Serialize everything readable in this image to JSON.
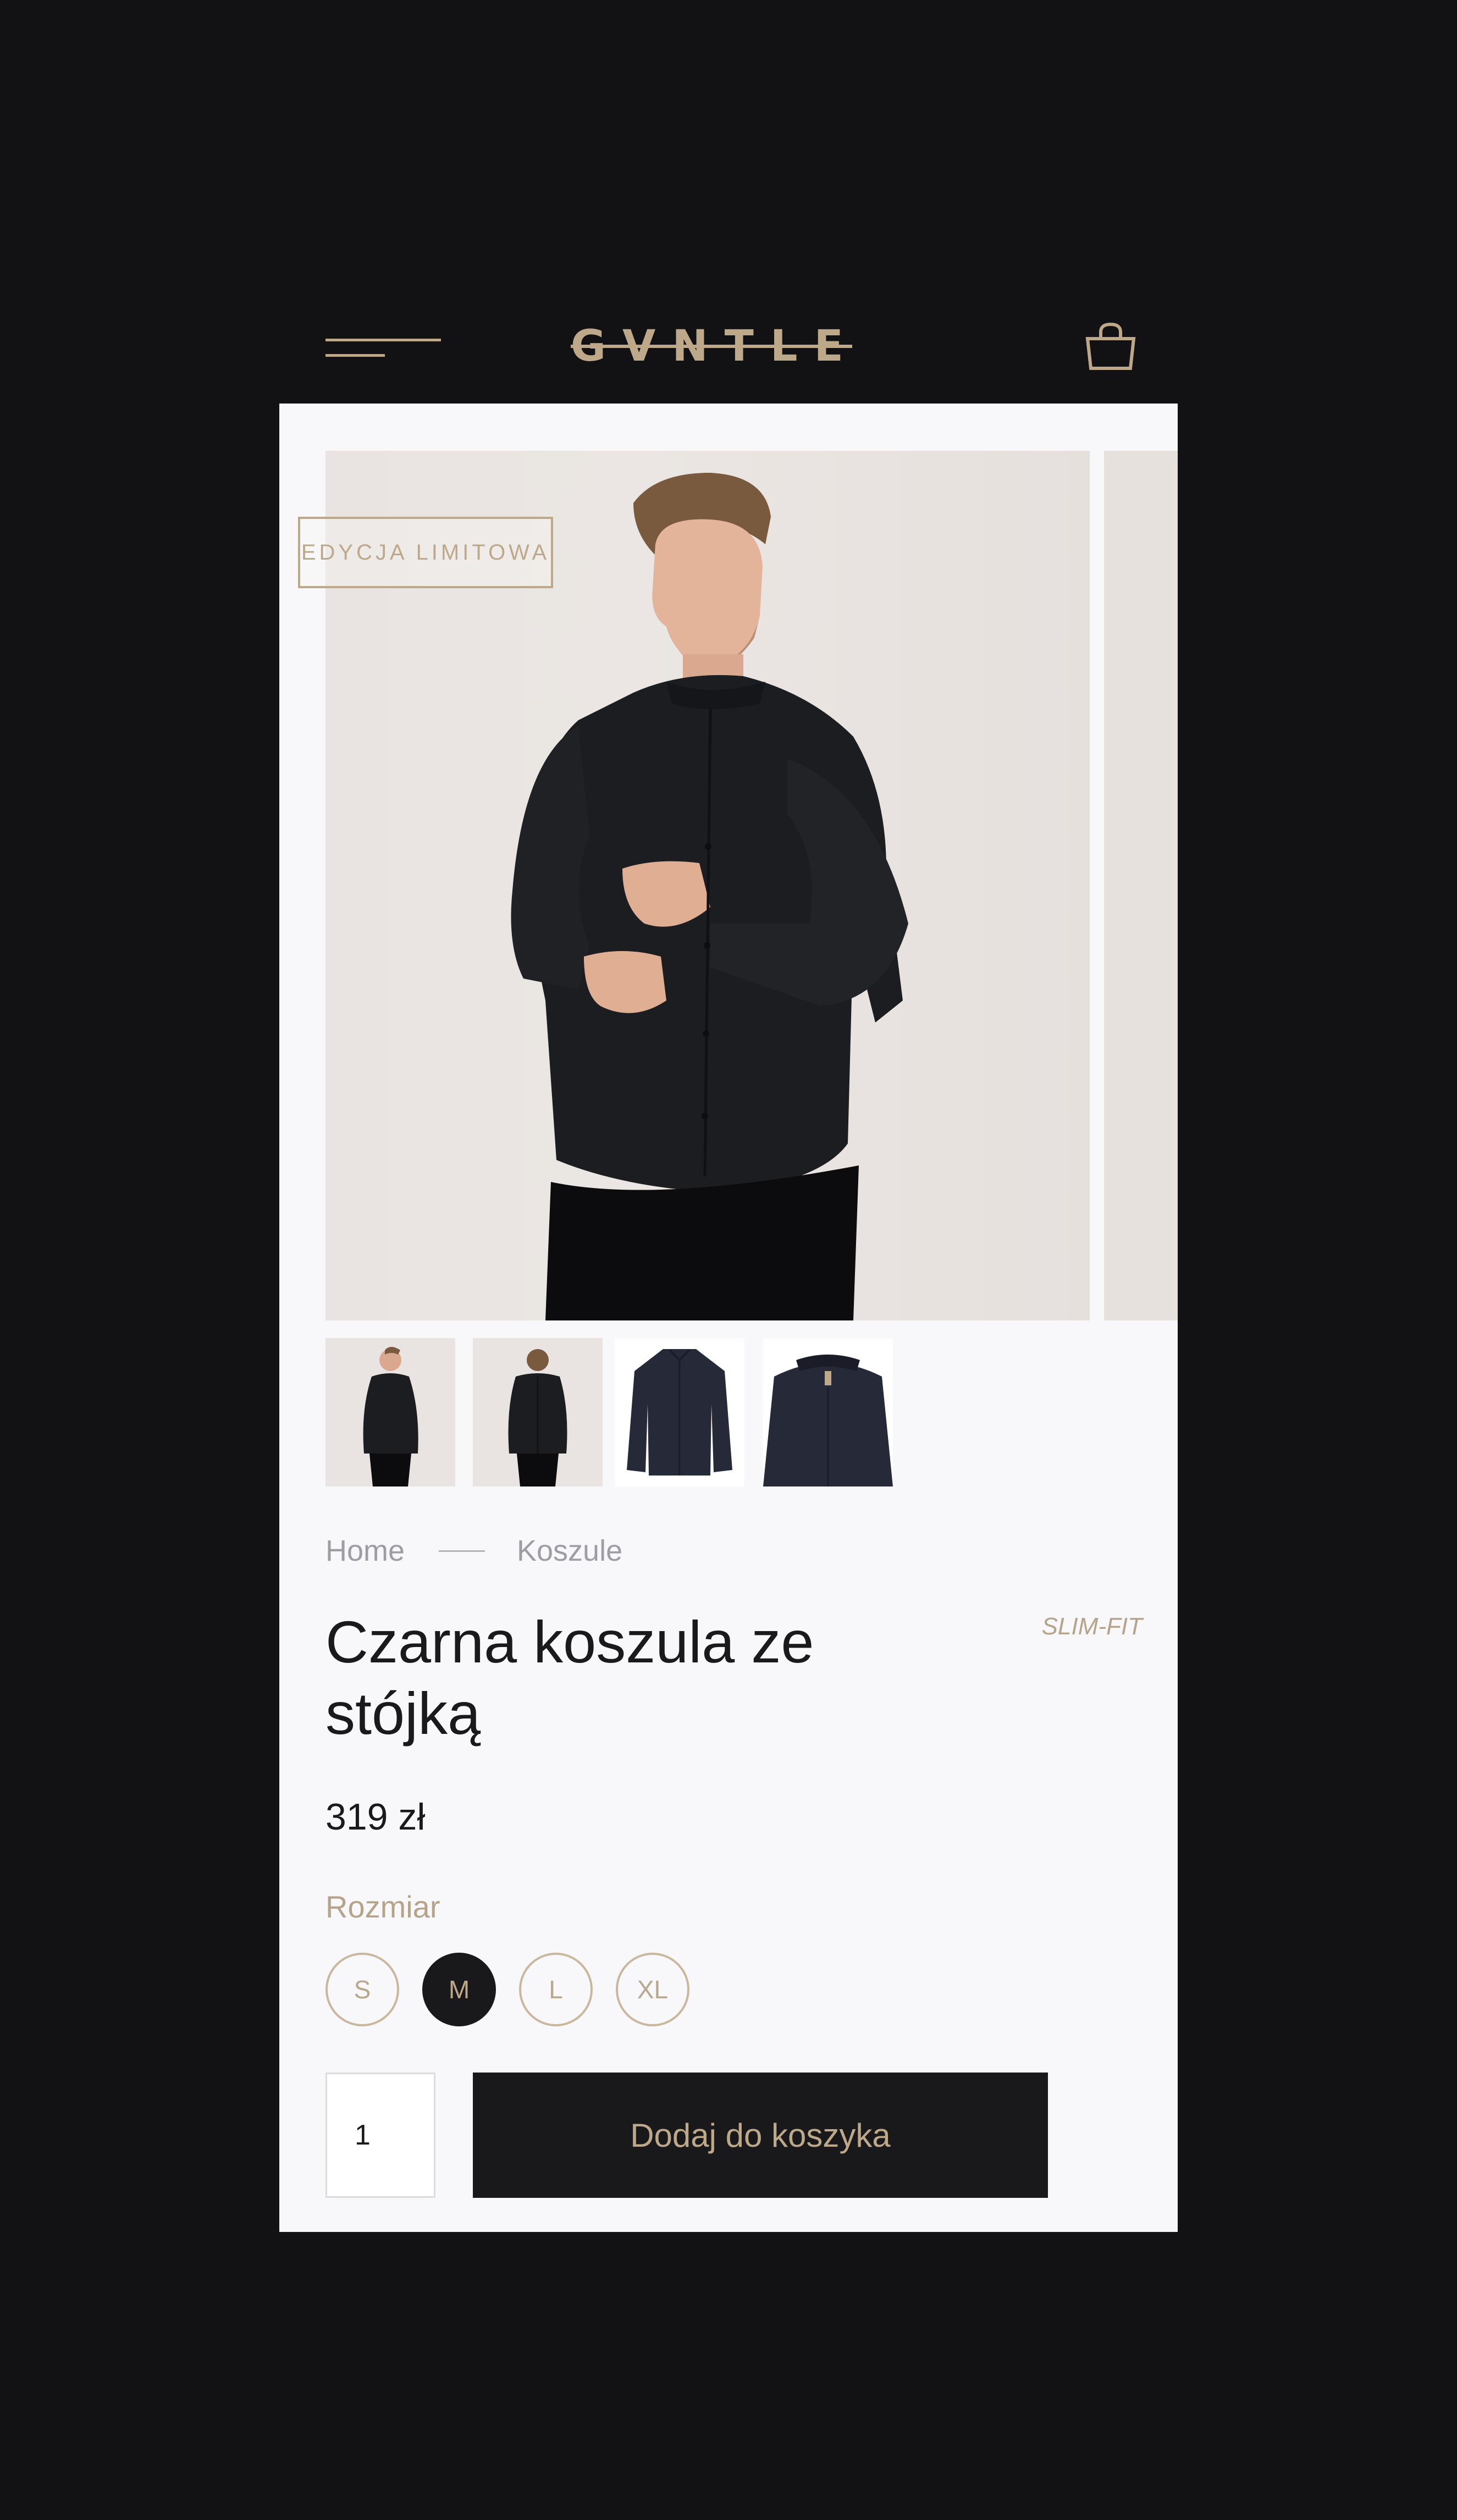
{
  "header": {
    "logo_text": "GVNTLE",
    "menu_icon": "hamburger-menu-icon",
    "cart_icon": "shopping-bag-icon",
    "accent_color": "#bda98a",
    "background_color": "#121114"
  },
  "gallery": {
    "badge": "EDYCJA LIMITOWA",
    "main_image": "man-in-black-shirt-photo",
    "thumbnails": [
      {
        "image": "man-front-thumbnail"
      },
      {
        "image": "man-back-thumbnail"
      },
      {
        "image": "shirt-flat-thumbnail"
      },
      {
        "image": "shirt-collar-closeup-thumbnail"
      }
    ]
  },
  "breadcrumb": {
    "items": [
      "Home",
      "Koszule"
    ]
  },
  "product": {
    "title": "Czarna koszula ze stójką",
    "fit": "SLIM-FIT",
    "price": "319 zł"
  },
  "size": {
    "label": "Rozmiar",
    "options": [
      "S",
      "M",
      "L",
      "XL"
    ],
    "selected": "M"
  },
  "purchase": {
    "quantity": "1",
    "add_to_cart_label": "Dodaj do koszyka"
  }
}
